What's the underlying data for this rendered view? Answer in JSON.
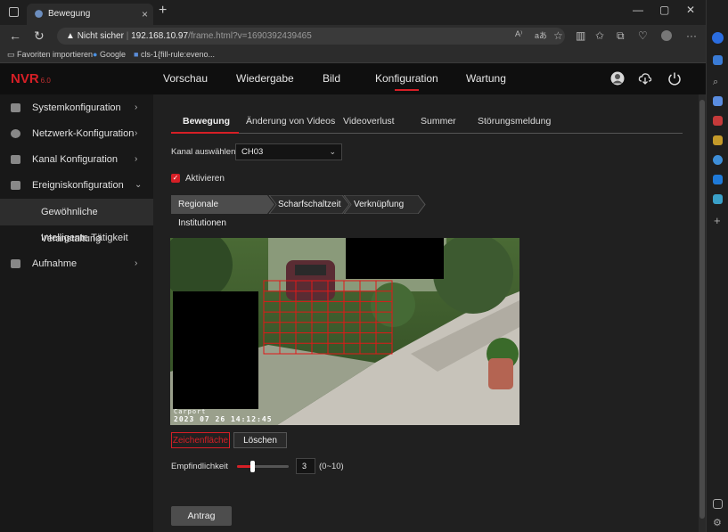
{
  "browser": {
    "tab_title": "Bewegung",
    "tab_close": "×",
    "new_tab": "+",
    "security_label": "Nicht sicher",
    "url_host": "192.168.10.97",
    "url_path": "/frame.html?v=1690392439465",
    "favorites": [
      "Favoriten importieren",
      "Google",
      "cls-1{fill-rule:eveno..."
    ],
    "window_controls": [
      "—",
      "▢",
      "✕"
    ],
    "toolbar_text": "aあ"
  },
  "app": {
    "logo": "NVR",
    "logo_version": "6.0",
    "topnav": [
      "Vorschau",
      "Wiedergabe",
      "Bild",
      "Konfiguration",
      "Wartung"
    ],
    "active_topnav": "Konfiguration"
  },
  "sidebar": {
    "items": [
      {
        "label": "Systemkonfiguration",
        "chev": "›"
      },
      {
        "label": "Netzwerk-Konfiguration",
        "chev": "›"
      },
      {
        "label": "Kanal Konfiguration",
        "chev": "›"
      },
      {
        "label": "Ereigniskonfiguration",
        "chev": "⌄"
      },
      {
        "label": "Gewöhnliche Veranstaltung"
      },
      {
        "label": "Intelligente Tätigkeit"
      },
      {
        "label": "Aufnahme",
        "chev": "›"
      }
    ]
  },
  "main": {
    "tabs": [
      "Bewegung",
      "Änderung von Videos",
      "Videoverlust",
      "Summer",
      "Störungsmeldung"
    ],
    "active_tab": "Bewegung",
    "channel_label": "Kanal auswählen",
    "channel_value": "CH03",
    "enable_label": "Aktivieren",
    "enabled": true,
    "steps": [
      "Regionale Institutionen",
      "Scharfschaltzeit",
      "Verknüpfung"
    ],
    "osd_text": "2023 07 26 14:12:45",
    "osd_name": "Carport",
    "draw_button": "Zeichenfläche",
    "clear_button": "Löschen",
    "sensitivity_label": "Empfindlichkeit",
    "sensitivity_value": "3",
    "sensitivity_range": "(0~10)",
    "sensitivity_fraction": 0.3,
    "apply_button": "Antrag"
  },
  "colors": {
    "accent": "#d61f26",
    "header_bg": "#0f0f0f",
    "sidebar_bg": "#181818",
    "main_bg": "#202020"
  }
}
